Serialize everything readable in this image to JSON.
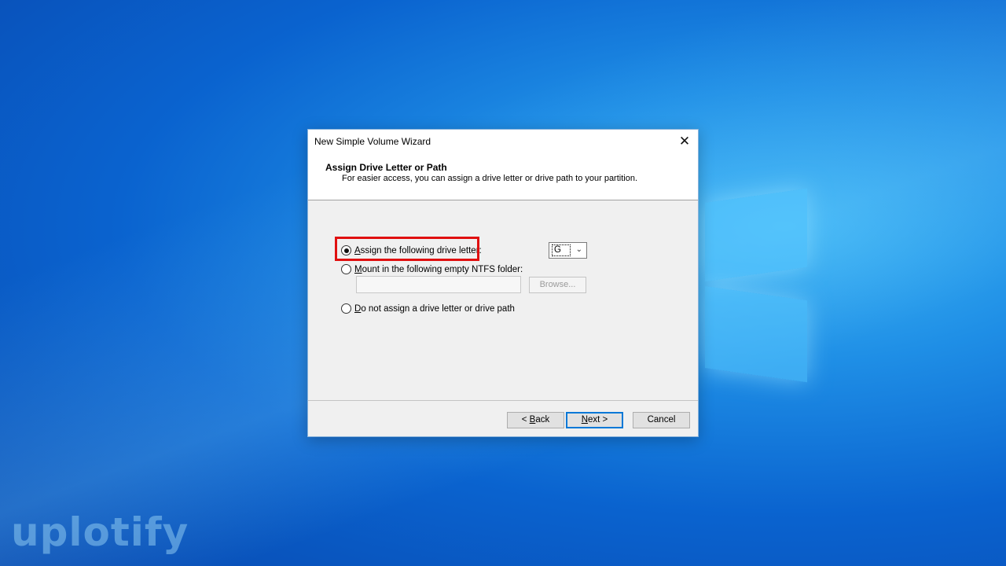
{
  "dialog": {
    "title": "New Simple Volume Wizard",
    "header_title": "Assign Drive Letter or Path",
    "header_subtitle": "For easier access, you can assign a drive letter or drive path to your partition."
  },
  "options": {
    "assign_letter": {
      "prefix": "A",
      "rest": "ssign the following drive letter:",
      "checked": true
    },
    "mount_folder": {
      "prefix": "M",
      "rest": "ount in the following empty NTFS folder:",
      "checked": false
    },
    "no_assign": {
      "prefix": "D",
      "rest": "o not assign a drive letter or drive path",
      "checked": false
    }
  },
  "drive_letter": {
    "selected": "G"
  },
  "browse_label": "Browse...",
  "buttons": {
    "back_pre": "< ",
    "back_key": "B",
    "back_rest": "ack",
    "next_key": "N",
    "next_rest": "ext >",
    "cancel": "Cancel"
  },
  "watermark": "uplotify",
  "colors": {
    "highlight": "#e01010",
    "default_button_border": "#0078d7",
    "desktop": "#0a63cf"
  }
}
